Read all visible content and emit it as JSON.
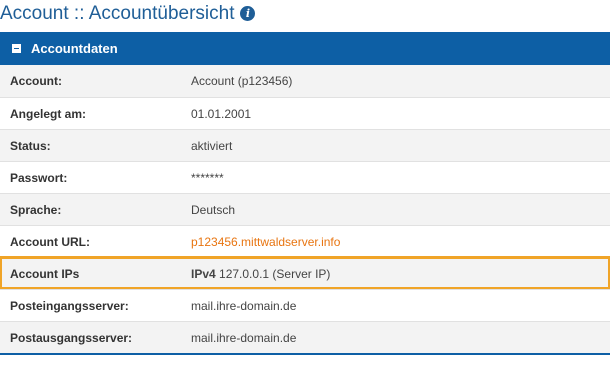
{
  "page": {
    "title": "Account :: Accountübersicht",
    "info_icon": "info-icon"
  },
  "panel": {
    "title": "Accountdaten",
    "collapse_icon": "minus-square-icon",
    "colors": {
      "header": "#0d5fa5",
      "highlight": "#f0a427",
      "link": "#e87511"
    }
  },
  "rows": [
    {
      "label": "Account:",
      "value": "Account (p123456)"
    },
    {
      "label": "Angelegt am:",
      "value": "01.01.2001"
    },
    {
      "label": "Status:",
      "value": "aktiviert"
    },
    {
      "label": "Passwort:",
      "value": "*******"
    },
    {
      "label": "Sprache:",
      "value": "Deutsch"
    },
    {
      "label": "Account URL:",
      "value": "p123456.mittwaldserver.info"
    },
    {
      "label": "Account IPs",
      "value_prefix": "IPv4",
      "value": "127.0.0.1 (Server IP)"
    },
    {
      "label": "Posteingangsserver:",
      "value": "mail.ihre-domain.de"
    },
    {
      "label": "Postausgangsserver:",
      "value": "mail.ihre-domain.de"
    }
  ]
}
